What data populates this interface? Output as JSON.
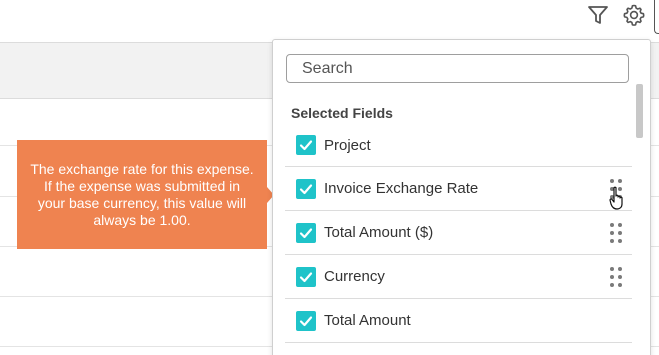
{
  "toolbar": {
    "filter_icon": "filter-icon",
    "settings_icon": "gear-icon"
  },
  "tooltip": {
    "text": "The exchange rate for this expense. If the expense was submitted in your base currency, this value will always be 1.00."
  },
  "field_picker": {
    "search_placeholder": "Search",
    "section_title": "Selected Fields",
    "fields": [
      {
        "label": "Project",
        "checked": true,
        "draggable": false
      },
      {
        "label": "Invoice Exchange Rate",
        "checked": true,
        "draggable": true
      },
      {
        "label": "Total Amount ($)",
        "checked": true,
        "draggable": true
      },
      {
        "label": "Currency",
        "checked": true,
        "draggable": true
      },
      {
        "label": "Total Amount",
        "checked": true,
        "draggable": false
      }
    ]
  },
  "colors": {
    "checkbox": "#1fc3c9",
    "tooltip": "#ef8350"
  }
}
